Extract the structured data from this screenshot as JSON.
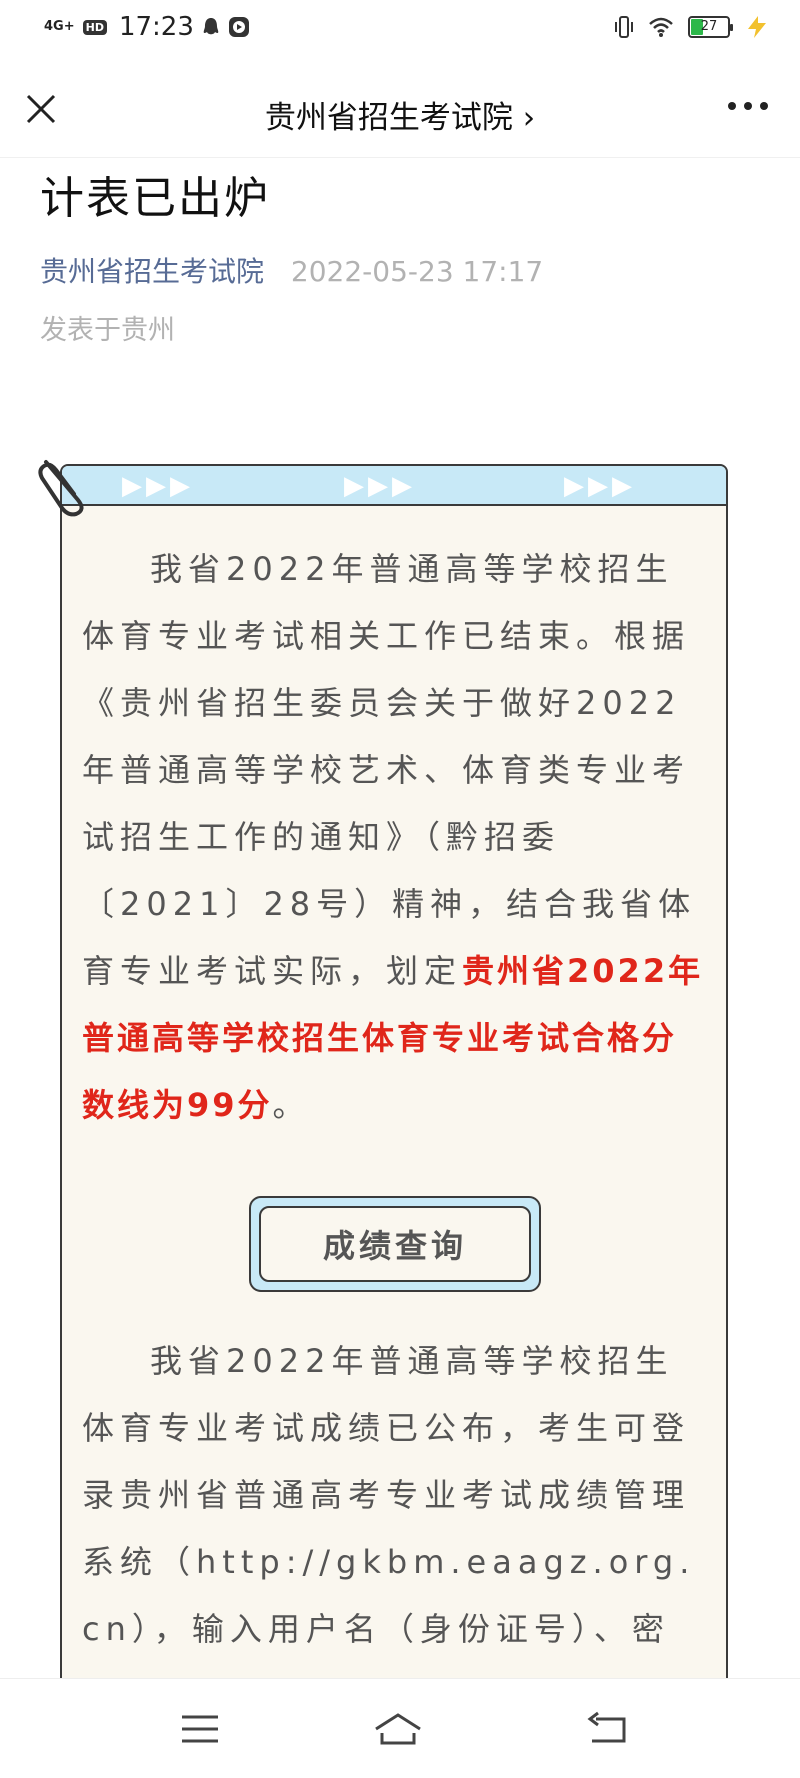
{
  "status_bar": {
    "network": "4G+",
    "hd": "HD",
    "time": "17:23",
    "battery_level": "27",
    "battery_color": "#2db84a"
  },
  "nav": {
    "title": "贵州省招生考试院 ›",
    "close_icon": "close-icon",
    "more_icon": "more-icon"
  },
  "article": {
    "title_fragment": "计表已出炉",
    "account": "贵州省招生考试院",
    "date": "2022-05-23 17:17",
    "location": "发表于贵州"
  },
  "card": {
    "arrows": "▶▶▶",
    "para1_normal": "我省2022年普通高等学校招生体育专业考试相关工作已结束。根据《贵州省招生委员会关于做好2022年普通高等学校艺术、体育类专业考试招生工作的通知》（黔招委〔2021〕28号）精神，结合我省体育专业考试实际，划定",
    "para1_highlight": "贵州省2022年普通高等学校招生体育专业考试合格分数线为99分",
    "para1_end": "。",
    "highlight_color": "#e0261a",
    "button_label": "成绩查询",
    "para2": "我省2022年普通高等学校招生体育专业考试成绩已公布，考生可登录贵州省普通高考专业考试成绩管理系统（http://gkbm.eaagz.org.cn），输入用户名（身份证号）、密码（报"
  },
  "bottom_nav": {
    "menu_icon": "menu-icon",
    "home_icon": "home-icon",
    "back_icon": "back-icon"
  }
}
